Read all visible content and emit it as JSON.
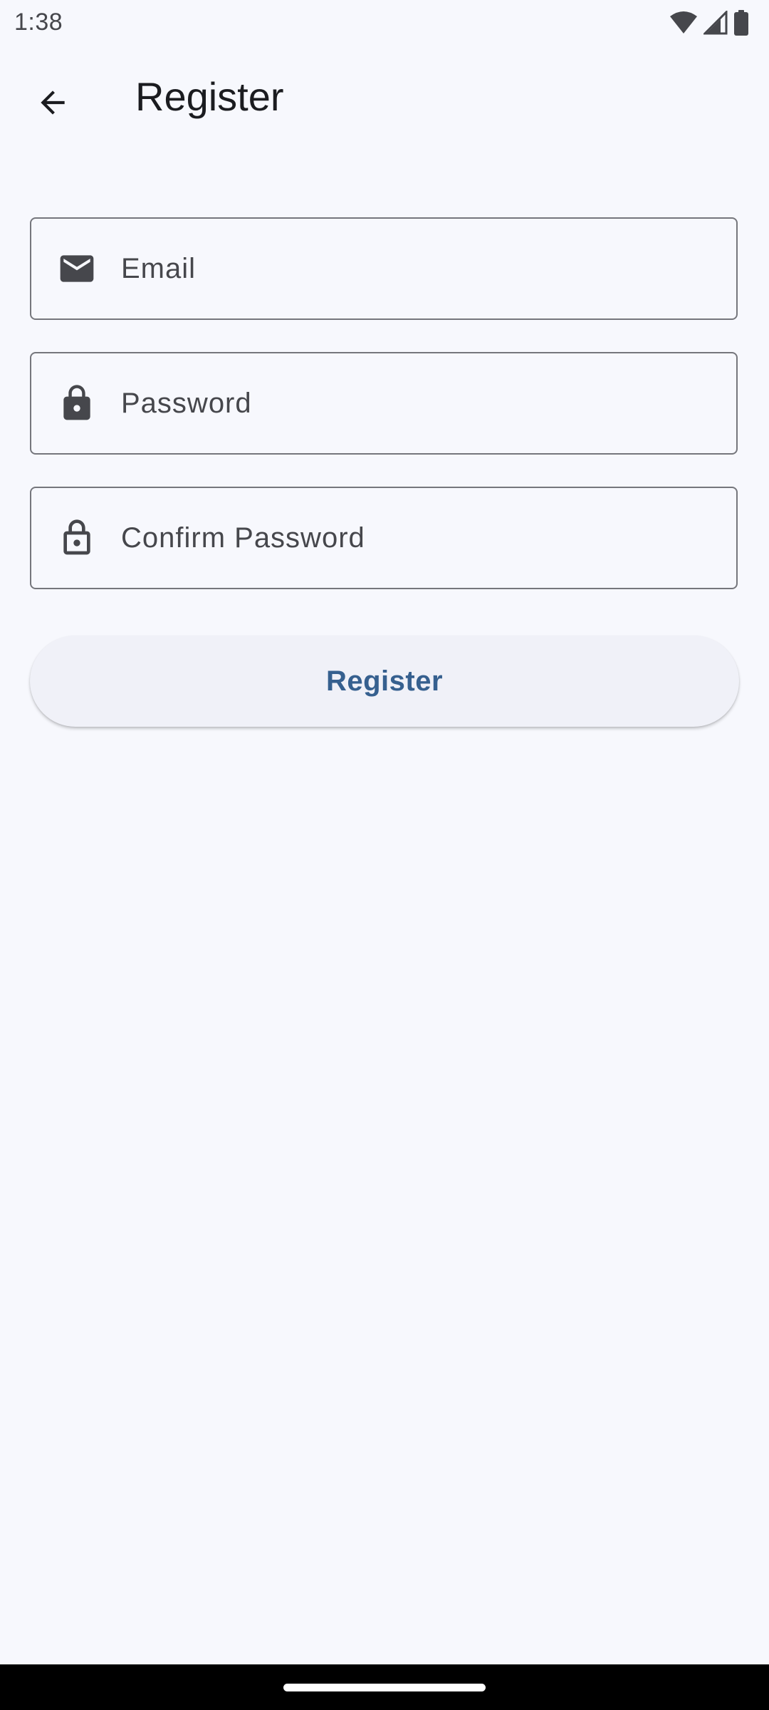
{
  "status_bar": {
    "time": "1:38",
    "icons": [
      "wifi-icon",
      "signal-icon",
      "battery-icon"
    ]
  },
  "app_bar": {
    "back_icon": "arrow-back-icon",
    "title": "Register"
  },
  "form": {
    "email": {
      "icon": "mail-icon",
      "placeholder": "Email",
      "value": ""
    },
    "password": {
      "icon": "lock-filled-icon",
      "placeholder": "Password",
      "value": ""
    },
    "confirm_password": {
      "icon": "lock-outlined-icon",
      "placeholder": "Confirm Password",
      "value": ""
    },
    "submit_label": "Register"
  },
  "colors": {
    "background": "#f7f8fd",
    "primary": "#36608f",
    "outline": "#75767c",
    "button_surface": "#f0f1f8"
  }
}
